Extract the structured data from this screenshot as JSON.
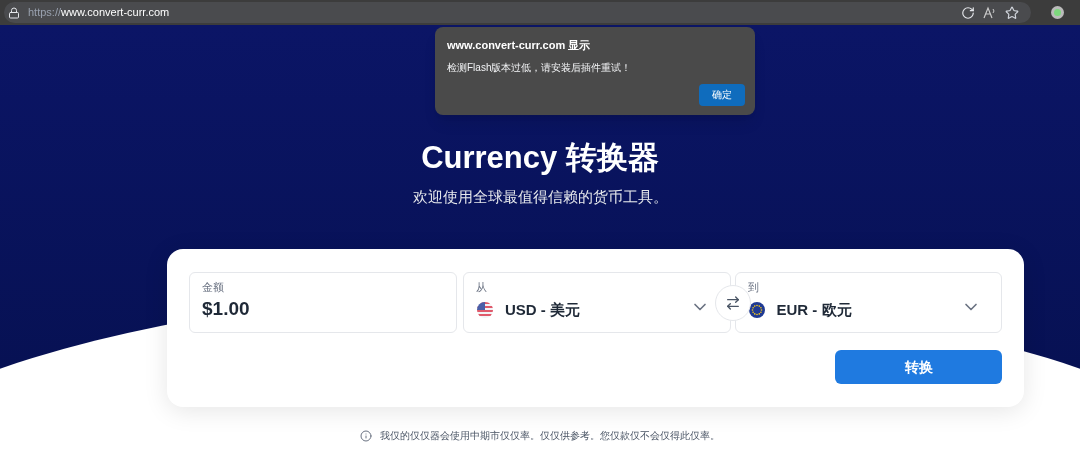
{
  "browser": {
    "url_scheme": "https://",
    "url_host": "www.convert-curr.com"
  },
  "dialog": {
    "title": "www.convert-curr.com 显示",
    "message": "检测Flash版本过低，请安装后插件重试！",
    "button": "确定"
  },
  "hero": {
    "title": "Currency 转换器",
    "subtitle": "欢迎使用全球最值得信赖的货币工具。"
  },
  "converter": {
    "amount": {
      "label": "金额",
      "value": "$1.00"
    },
    "from": {
      "label": "从",
      "value": "USD - 美元",
      "kind": "us"
    },
    "to": {
      "label": "到",
      "value": "EUR - 欧元",
      "kind": "eu"
    },
    "button": "转换"
  },
  "note": "我仅的仅仅器会使用中期市仅仅率。仅仅供参考。您仅款仅不会仅得此仅率。"
}
